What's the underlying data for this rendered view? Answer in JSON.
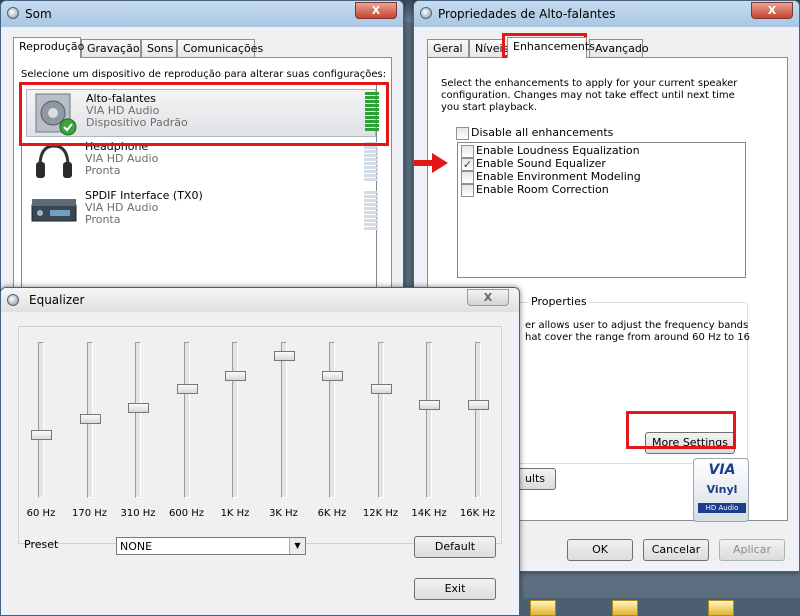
{
  "sound_window": {
    "title": "Som",
    "close": "X",
    "tabs": [
      "Reprodução",
      "Gravação",
      "Sons",
      "Comunicações"
    ],
    "instruction": "Selecione um dispositivo de reprodução para alterar suas configurações:",
    "devices": [
      {
        "name": "Alto-falantes",
        "driver": "VIA HD Audio",
        "status": "Dispositivo Padrão",
        "level": 1.0
      },
      {
        "name": "Headphone",
        "driver": "VIA HD Audio",
        "status": "Pronta",
        "level": 0.0
      },
      {
        "name": "SPDIF Interface (TX0)",
        "driver": "VIA HD Audio",
        "status": "Pronta",
        "level": 0.0
      }
    ]
  },
  "props_window": {
    "title": "Propriedades de Alto-falantes",
    "close": "X",
    "tabs": [
      "Geral",
      "Níveis",
      "Enhancements",
      "Avançado"
    ],
    "description": "Select the enhancements to apply for your current speaker configuration. Changes may not take effect until next time you start playback.",
    "disable_all": "Disable all enhancements",
    "enhancements": [
      {
        "label": "Enable Loudness Equalization",
        "checked": false
      },
      {
        "label": "Enable Sound Equalizer",
        "checked": true
      },
      {
        "label": "Enable Environment Modeling",
        "checked": false
      },
      {
        "label": "Enable Room Correction",
        "checked": false
      }
    ],
    "properties_group": "Properties",
    "properties_text_1": "er allows user to adjust the frequency bands",
    "properties_text_2": "hat cover the range from around 60 Hz to 16",
    "more_settings": "More Settings",
    "defaults_fragment": "ults",
    "badge": {
      "line1": "VIA",
      "line2": "Vinyl",
      "line3": "HD Audio"
    },
    "ok": "OK",
    "cancel": "Cancelar",
    "apply": "Aplicar",
    "check_mark": "✓"
  },
  "equalizer": {
    "title": "Equalizer",
    "close": "X",
    "bands": [
      {
        "label": "60 Hz",
        "level": 0.4
      },
      {
        "label": "170 Hz",
        "level": 0.51
      },
      {
        "label": "310 Hz",
        "level": 0.58
      },
      {
        "label": "600 Hz",
        "level": 0.71
      },
      {
        "label": "1K Hz",
        "level": 0.8
      },
      {
        "label": "3K Hz",
        "level": 0.94
      },
      {
        "label": "6K Hz",
        "level": 0.8
      },
      {
        "label": "12K Hz",
        "level": 0.71
      },
      {
        "label": "14K Hz",
        "level": 0.6
      },
      {
        "label": "16K Hz",
        "level": 0.6
      }
    ],
    "preset_label": "Preset",
    "preset_value": "NONE",
    "dropdown_arrow": "▼",
    "default_button": "Default",
    "exit_button": "Exit"
  },
  "colors": {
    "highlight": "#e3161a",
    "meter_active": "#2fa13a"
  }
}
